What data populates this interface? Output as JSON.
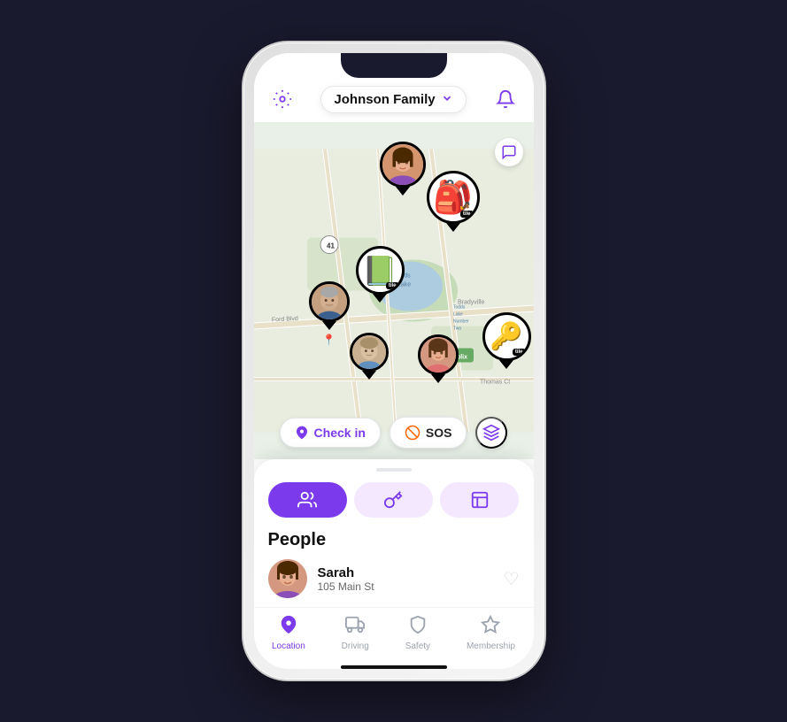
{
  "phone": {
    "header": {
      "family_name": "Johnson Family",
      "gear_icon": "⚙",
      "bell_icon": "🔔",
      "chevron": "▾",
      "chat_icon": "💬"
    },
    "map": {
      "check_in_label": "Check in",
      "sos_label": "SOS",
      "layers_icon": "⊞"
    },
    "tabs": [
      {
        "id": "people",
        "icon": "👥",
        "active": true
      },
      {
        "id": "items",
        "icon": "🔑",
        "active": false
      },
      {
        "id": "places",
        "icon": "🏢",
        "active": false
      }
    ],
    "people_section": {
      "title": "People",
      "members": [
        {
          "name": "Sarah",
          "location": "105 Main St"
        }
      ]
    },
    "bottom_nav": [
      {
        "id": "location",
        "label": "Location",
        "icon": "📍",
        "active": true
      },
      {
        "id": "driving",
        "label": "Driving",
        "icon": "🚗",
        "active": false
      },
      {
        "id": "safety",
        "label": "Safety",
        "icon": "🛡",
        "active": false
      },
      {
        "id": "membership",
        "label": "Membership",
        "icon": "⭐",
        "active": false
      }
    ]
  }
}
